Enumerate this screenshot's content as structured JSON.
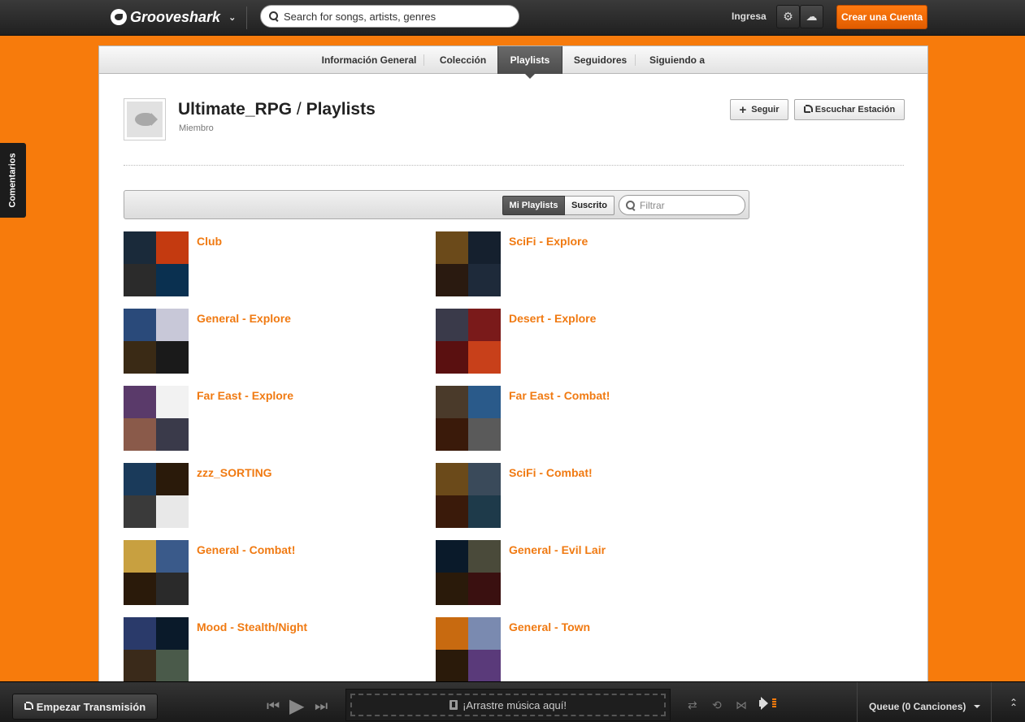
{
  "topbar": {
    "logo": "Grooveshark",
    "search_placeholder": "Search for songs, artists, genres",
    "login": "Ingresa",
    "create_account": "Crear una Cuenta"
  },
  "sidebar_tab": "Comentarios",
  "subnav": {
    "tabs": [
      "Información General",
      "Colección",
      "Playlists",
      "Seguidores",
      "Siguiendo a"
    ],
    "active": "Playlists"
  },
  "profile": {
    "username": "Ultimate_RPG",
    "section": "Playlists",
    "role": "Miembro",
    "follow_label": "Seguir",
    "station_label": "Escuchar Estación"
  },
  "listbar": {
    "tab_mine": "Mi Playlists",
    "tab_subscribed": "Suscrito",
    "filter_placeholder": "Filtrar"
  },
  "playlists": [
    {
      "name": "Club",
      "colors": [
        "#1a2a3a",
        "#c43a10",
        "#2b2b2b",
        "#0a3050"
      ]
    },
    {
      "name": "SciFi - Explore",
      "colors": [
        "#6b4a1a",
        "#15202e",
        "#2a1a10",
        "#1e2a3a"
      ]
    },
    {
      "name": "General - Explore",
      "colors": [
        "#2a4a7a",
        "#c8c8d8",
        "#3a2a15",
        "#1a1a1a"
      ]
    },
    {
      "name": "Desert - Explore",
      "colors": [
        "#3a3a4a",
        "#7a1a1a",
        "#5a1010",
        "#c8401a"
      ]
    },
    {
      "name": "Far East - Explore",
      "colors": [
        "#5a3a6a",
        "#f2f2f2",
        "#8a5a4a",
        "#3a3a4a"
      ]
    },
    {
      "name": "Far East - Combat!",
      "colors": [
        "#4a3a2a",
        "#2a5a8a",
        "#3a1a0a",
        "#5a5a5a"
      ]
    },
    {
      "name": "zzz_SORTING",
      "colors": [
        "#1a3a5a",
        "#2a1a0a",
        "#3a3a3a",
        "#e8e8e8"
      ]
    },
    {
      "name": "SciFi - Combat!",
      "colors": [
        "#6b4a1a",
        "#3a4a5a",
        "#3a1a0a",
        "#1e3a4a"
      ]
    },
    {
      "name": "General - Combat!",
      "colors": [
        "#c8a040",
        "#3a5a8a",
        "#2a1a0a",
        "#2a2a2a"
      ]
    },
    {
      "name": "General - Evil Lair",
      "colors": [
        "#0a1a2a",
        "#4a4a3a",
        "#2a1a0a",
        "#3a1010"
      ]
    },
    {
      "name": "Mood - Stealth/Night",
      "colors": [
        "#2a3a6a",
        "#0a1a2a",
        "#3a2a1a",
        "#4a5a4a"
      ]
    },
    {
      "name": "General - Town",
      "colors": [
        "#c86a10",
        "#7a8ab0",
        "#2a1a0a",
        "#5a3a7a"
      ]
    }
  ],
  "player": {
    "broadcast_label": "Empezar Transmisión",
    "dropzone_label": "¡Arrastre música aquí!",
    "queue_label": "Queue (0 Canciones)"
  }
}
